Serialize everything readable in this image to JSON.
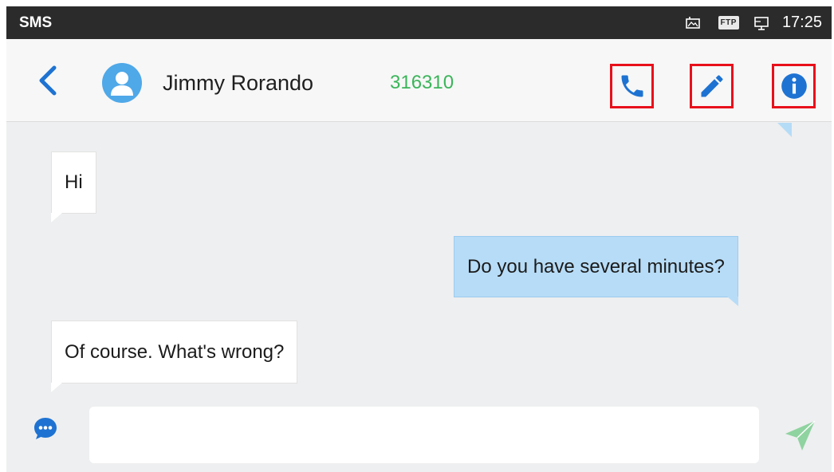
{
  "status_bar": {
    "app_label": "SMS",
    "ftp_badge": "FTP",
    "time": "17:25",
    "icons": [
      "screenshot-icon",
      "ftp-icon",
      "screen-share-icon"
    ]
  },
  "header": {
    "contact_name": "Jimmy Rorando",
    "contact_number": "316310",
    "icons": [
      "back-icon",
      "avatar-icon",
      "phone-icon",
      "pencil-icon",
      "info-icon"
    ]
  },
  "messages": [
    {
      "direction": "incoming",
      "text": "Hi"
    },
    {
      "direction": "outgoing",
      "text": "Do you have several minutes?"
    },
    {
      "direction": "incoming",
      "text": "Of  course. What's wrong?"
    }
  ],
  "composer": {
    "value": "",
    "placeholder": "",
    "icons": [
      "more-options-icon",
      "send-icon"
    ]
  },
  "colors": {
    "accent_blue": "#1e73d2",
    "number_green": "#3bb55a",
    "highlight_red": "#e8101b",
    "send_green": "#8fd3a0",
    "outgoing_bubble": "#b7dcf7"
  }
}
